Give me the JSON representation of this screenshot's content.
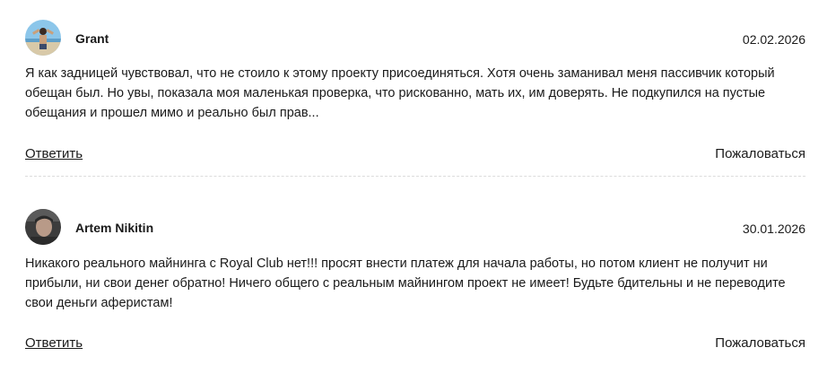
{
  "comments": [
    {
      "author": "Grant",
      "date": "02.02.2026",
      "text": "Я как задницей чувствовал, что не стоило к этому проекту присоединяться. Хотя очень заманивал меня пассивчик который обещан был. Но увы, показала моя маленькая проверка, что рискованно, мать их, им доверять. Не подкупился на пустые обещания и прошел мимо и реально был прав...",
      "reply_label": "Ответить",
      "report_label": "Пожаловаться"
    },
    {
      "author": "Artem Nikitin",
      "date": "30.01.2026",
      "text": "Никакого реального майнинга с Royal Club нет!!! просят внести платеж для начала работы, но потом клиент не получит ни прибыли, ни свои денег обратно! Ничего общего с реальным майнингом проект не имеет! Будьте бдительны и не переводите свои деньги аферистам!",
      "reply_label": "Ответить",
      "report_label": "Пожаловаться"
    }
  ]
}
